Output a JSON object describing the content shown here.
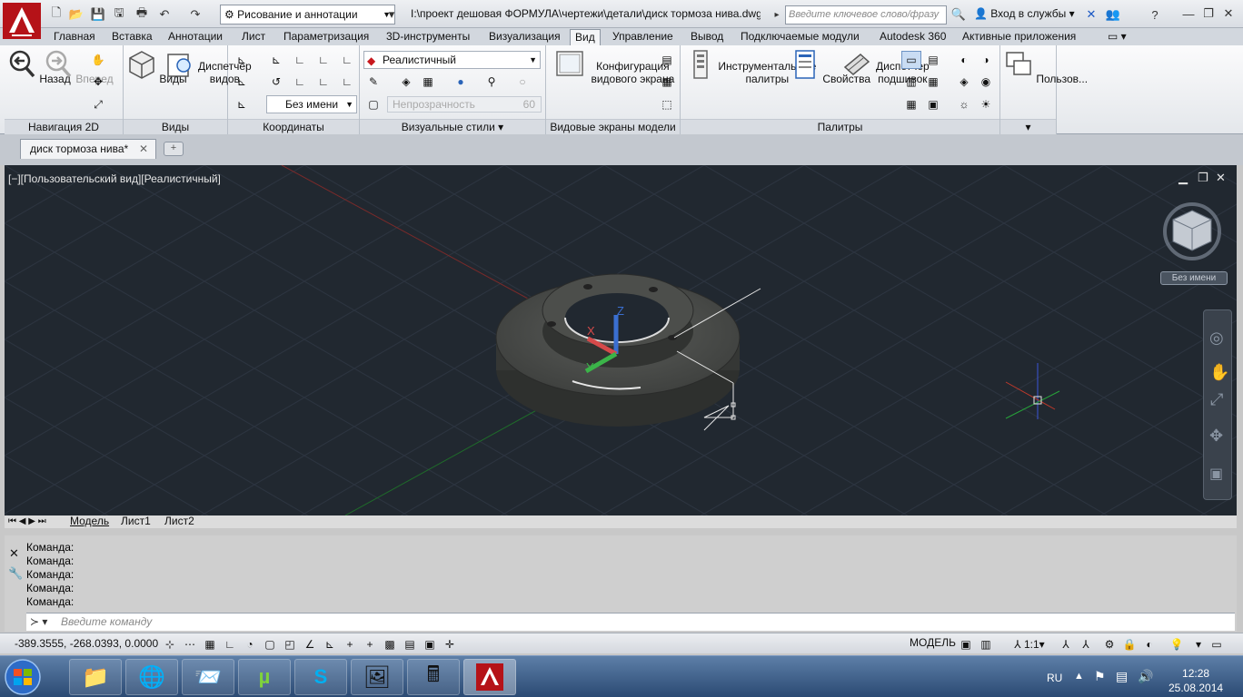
{
  "titlebar": {
    "workspace": "Рисование и аннотации",
    "doc_path": "I:\\проект дешовая ФОРМУЛА\\чертежи\\детали\\диск тормоза нива.dwg",
    "search_placeholder": "Введите ключевое слово/фразу",
    "signin": "Вход в службы"
  },
  "ribbon_tabs": [
    "Главная",
    "Вставка",
    "Аннотации",
    "Лист",
    "Параметризация",
    "3D-инструменты",
    "Визуализация",
    "Вид",
    "Управление",
    "Вывод",
    "Подключаемые модули",
    "Autodesk 360",
    "Активные приложения"
  ],
  "active_tab": "Вид",
  "panels": {
    "nav2d": {
      "title": "Навигация 2D",
      "back": "Назад",
      "forward": "Вперед"
    },
    "views": {
      "title": "Виды",
      "views_btn": "Виды",
      "manager": "Диспетчер видов"
    },
    "coords": {
      "title": "Координаты",
      "ucs_name": "Без имени"
    },
    "visual_styles": {
      "title": "Визуальные стили",
      "style": "Реалистичный",
      "opacity_label": "Непрозрачность",
      "opacity_value": "60"
    },
    "model_viewports": {
      "title": "Видовые экраны модели",
      "config": "Конфигурация видового экрана"
    },
    "palettes": {
      "title": "Палитры",
      "tool_palettes": "Инструментальные палитры",
      "properties": "Свойства",
      "sheet_set": "Диспетчер подшивок"
    },
    "user": {
      "label": "Пользов..."
    }
  },
  "document_tab": "диск тормоза нива*",
  "viewport": {
    "label": "[−][Пользовательский вид][Реалистичный]",
    "viewcube_label": "Без имени",
    "ucs_label_z": "Z",
    "ucs_label_y": "Y",
    "ucs_label_x": "X"
  },
  "layout_tabs": [
    "Модель",
    "Лист1",
    "Лист2"
  ],
  "command_history": [
    "Команда:",
    "Команда:",
    "Команда:",
    "Команда:",
    "Команда:"
  ],
  "command_placeholder": "Введите команду",
  "status": {
    "coordinates": "-389.3555, -268.0393, 0.0000",
    "model": "МОДЕЛЬ",
    "scale": "1:1"
  },
  "taskbar": {
    "lang": "RU",
    "time": "12:28",
    "date": "25.08.2014"
  },
  "colors": {
    "viewport_bg": "#212830",
    "app_red": "#c8181e",
    "axis_red": "#c0392b",
    "axis_green": "#27a33a"
  }
}
